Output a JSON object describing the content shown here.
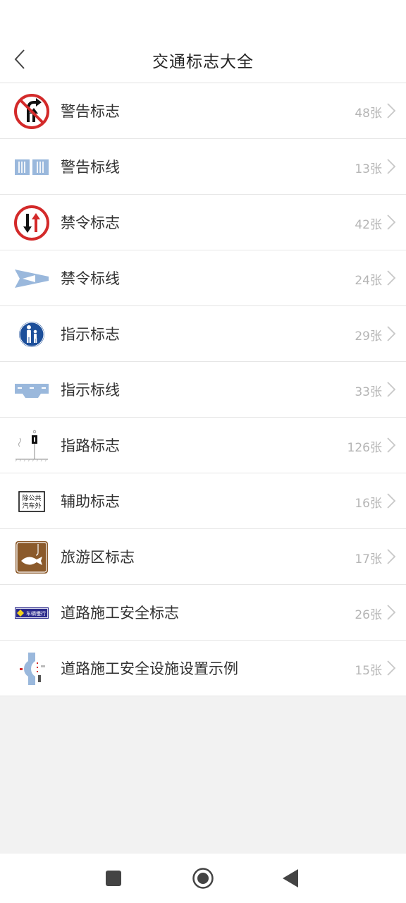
{
  "header": {
    "title": "交通标志大全"
  },
  "items": [
    {
      "label": "警告标志",
      "count": "48张",
      "icon": "no-turn-sign-icon"
    },
    {
      "label": "警告标线",
      "count": "13张",
      "icon": "road-marking-icon"
    },
    {
      "label": "禁令标志",
      "count": "42张",
      "icon": "oncoming-priority-sign-icon"
    },
    {
      "label": "禁令标线",
      "count": "24张",
      "icon": "lane-merge-marking-icon"
    },
    {
      "label": "指示标志",
      "count": "29张",
      "icon": "pedestrian-sign-icon"
    },
    {
      "label": "指示标线",
      "count": "33张",
      "icon": "lane-guide-marking-icon"
    },
    {
      "label": "指路标志",
      "count": "126张",
      "icon": "signpost-icon"
    },
    {
      "label": "辅助标志",
      "count": "16张",
      "icon": "auxiliary-sign-icon",
      "sign_text": [
        "除公共",
        "汽车外"
      ]
    },
    {
      "label": "旅游区标志",
      "count": "17张",
      "icon": "fishing-sign-icon"
    },
    {
      "label": "道路施工安全标志",
      "count": "26张",
      "icon": "construction-sign-icon",
      "sign_text": "车辆慢行"
    },
    {
      "label": "道路施工安全设施设置示例",
      "count": "15张",
      "icon": "construction-layout-icon"
    }
  ],
  "colors": {
    "accent_red": "#d32a2a",
    "sign_blue": "#1d4f9a",
    "marking_blue": "#9ab8dc",
    "tourism_brown": "#8b5a2b"
  }
}
